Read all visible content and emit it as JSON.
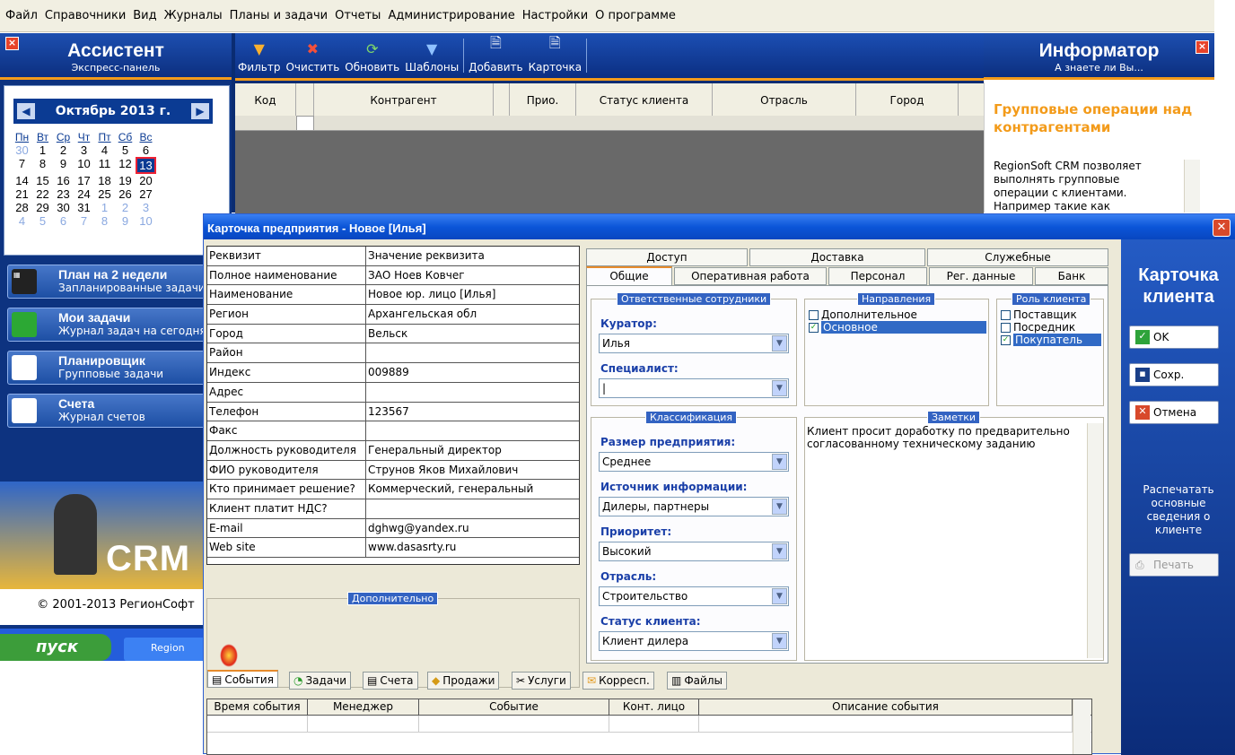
{
  "menu": [
    "Файл",
    "Справочники",
    "Вид",
    "Журналы",
    "Планы и задачи",
    "Отчеты",
    "Администрирование",
    "Настройки",
    "О программе"
  ],
  "assistant": {
    "title": "Ассистент",
    "subtitle": "Экспресс-панель",
    "calendar": {
      "month": "Октябрь 2013 г.",
      "weekdays": [
        "Пн",
        "Вт",
        "Ср",
        "Чт",
        "Пт",
        "Сб",
        "Вс"
      ],
      "weeks": [
        [
          "30",
          "1",
          "2",
          "3",
          "4",
          "5",
          "6"
        ],
        [
          "7",
          "8",
          "9",
          "10",
          "11",
          "12",
          "13"
        ],
        [
          "14",
          "15",
          "16",
          "17",
          "18",
          "19",
          "20"
        ],
        [
          "21",
          "22",
          "23",
          "24",
          "25",
          "26",
          "27"
        ],
        [
          "28",
          "29",
          "30",
          "31",
          "1",
          "2",
          "3"
        ],
        [
          "4",
          "5",
          "6",
          "7",
          "8",
          "9",
          "10"
        ]
      ],
      "today": "13"
    },
    "nav": [
      {
        "title": "План на 2 недели",
        "sub": "Запланированные задачи"
      },
      {
        "title": "Мои задачи",
        "sub": "Журнал задач на сегодня"
      },
      {
        "title": "Планировщик",
        "sub": "Групповые задачи"
      },
      {
        "title": "Счета",
        "sub": "Журнал счетов"
      }
    ],
    "logo_text": "CRM",
    "copyright": "© 2001-2013 РегионСофт",
    "start_button": "пуск",
    "taskbar_item": "Region"
  },
  "toolbar": {
    "items": [
      "Фильтр",
      "Очистить",
      "Обновить",
      "Шаблоны",
      "Добавить",
      "Карточка"
    ]
  },
  "grid": {
    "columns": [
      "Код",
      "",
      "Контрагент",
      "",
      "Прио.",
      "Статус клиента",
      "Отрасль",
      "Город"
    ]
  },
  "informer": {
    "title": "Информатор",
    "subtitle": "А знаете ли Вы...",
    "headline": "Групповые операции над контрагентами",
    "text": "RegionSoft CRM позволяет выполнять групповые операции с клиентами. Например такие как"
  },
  "dialog": {
    "title": "Карточка предприятия - Новое [Илья]",
    "requisites_header": [
      "Реквизит",
      "Значение реквизита"
    ],
    "requisites": [
      [
        "Полное наименование",
        "ЗАО Ноев Ковчег"
      ],
      [
        "Наименование",
        "Новое юр. лицо [Илья]"
      ],
      [
        "Регион",
        "Архангельская обл"
      ],
      [
        "Город",
        "Вельск"
      ],
      [
        "Район",
        ""
      ],
      [
        "Индекс",
        "009889"
      ],
      [
        "Адрес",
        ""
      ],
      [
        "Телефон",
        "123567"
      ],
      [
        "Факс",
        ""
      ],
      [
        "Должность руководителя",
        "Генеральный директор"
      ],
      [
        "ФИО руководителя",
        "Струнов Яков Михайлович"
      ],
      [
        "Кто принимает решение?",
        "Коммерческий, генеральный"
      ],
      [
        "Клиент платит НДС?",
        ""
      ],
      [
        "E-mail",
        "dghwg@yandex.ru"
      ],
      [
        "Web site",
        "www.dasasrty.ru"
      ]
    ],
    "extra_label": "Дополнительно",
    "tabs_row1": [
      "Доступ",
      "Доставка",
      "Служебные"
    ],
    "tabs_row2": [
      "Общие",
      "Оперативная работа",
      "Персонал",
      "Рег. данные",
      "Банк"
    ],
    "responsible": {
      "title": "Ответственные сотрудники",
      "curator_label": "Куратор:",
      "curator": "Илья",
      "specialist_label": "Специалист:",
      "specialist": ""
    },
    "directions": {
      "title": "Направления",
      "items": [
        {
          "label": "Дополнительное",
          "checked": false,
          "selected": false
        },
        {
          "label": "Основное",
          "checked": true,
          "selected": true
        }
      ]
    },
    "role": {
      "title": "Роль клиента",
      "items": [
        {
          "label": "Поставщик",
          "checked": false,
          "selected": false
        },
        {
          "label": "Посредник",
          "checked": false,
          "selected": false
        },
        {
          "label": "Покупатель",
          "checked": true,
          "selected": true
        }
      ]
    },
    "classification": {
      "title": "Классификация",
      "fields": [
        {
          "label": "Размер предприятия:",
          "value": "Среднее"
        },
        {
          "label": "Источник информации:",
          "value": "Дилеры, партнеры"
        },
        {
          "label": "Приоритет:",
          "value": "Высокий"
        },
        {
          "label": "Отрасль:",
          "value": "Строительство"
        },
        {
          "label": "Статус клиента:",
          "value": "Клиент дилера"
        }
      ]
    },
    "notes": {
      "title": "Заметки",
      "text": "Клиент просит доработку по предварительно согласованному техническому заданию"
    },
    "side": {
      "title": "Карточка клиента",
      "ok": "OK",
      "save": "Сохр.",
      "cancel": "Отмена",
      "print_hint": "Распечатать основные сведения о клиенте",
      "print": "Печать"
    },
    "bottom_tabs": [
      "События",
      "Задачи",
      "Счета",
      "Продажи",
      "Услуги",
      "Корресп.",
      "Файлы"
    ],
    "events_columns": [
      "Время события",
      "Менеджер",
      "Событие",
      "Конт. лицо",
      "Описание события"
    ]
  },
  "colors": {
    "brand_blue": "#0b3b93",
    "accent_orange": "#f39b1a",
    "label_blue": "#1a3fa8"
  }
}
